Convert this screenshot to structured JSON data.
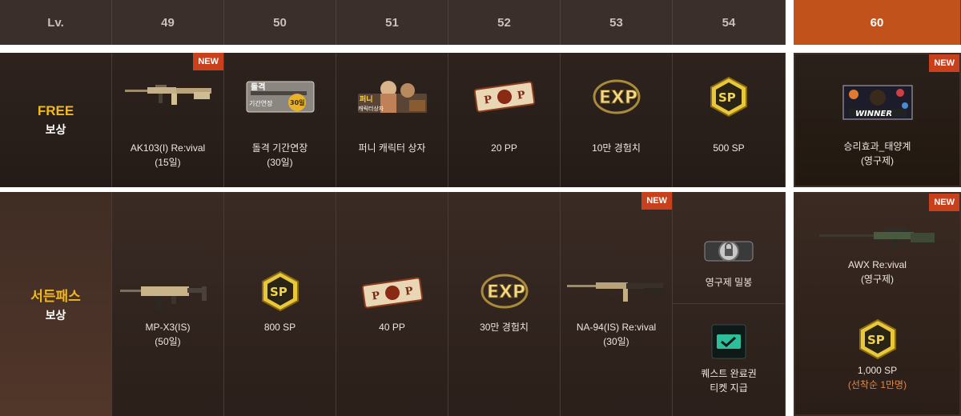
{
  "header": {
    "level_label": "Lv.",
    "levels": [
      "49",
      "50",
      "51",
      "52",
      "53",
      "54"
    ],
    "final_level": "60"
  },
  "free_row": {
    "title": "FREE",
    "subtitle": "보상",
    "items": [
      {
        "name": "AK103(I) Re:vival",
        "sub": "(15일)",
        "new": "NEW",
        "icon": "rifle-icon"
      },
      {
        "name": "돌격 기간연장",
        "sub": "(30일)",
        "icon": "extension-ticket-icon",
        "icon_text": "돌격\n기간연장",
        "icon_badge": "30일"
      },
      {
        "name": "퍼니 캐릭터 상자",
        "sub": "",
        "icon": "character-box-icon",
        "icon_text": "퍼니\n캐릭터상자"
      },
      {
        "name": "20 PP",
        "sub": "",
        "icon": "pp-ticket-icon",
        "icon_text": "P O P"
      },
      {
        "name": "10만 경험치",
        "sub": "",
        "icon": "exp-badge-icon",
        "icon_text": "EXP"
      },
      {
        "name": "500 SP",
        "sub": "",
        "icon": "sp-badge-icon",
        "icon_text": "SP"
      }
    ],
    "final": {
      "name": "승리효과_태양계",
      "sub": "(영구제)",
      "new": "NEW",
      "icon": "winner-effect-icon",
      "icon_text": "WINNER"
    }
  },
  "sudden_row": {
    "title": "서든패스",
    "subtitle": "보상",
    "items": [
      {
        "name": "MP-X3(IS)",
        "sub": "(50일)",
        "icon": "smg-icon"
      },
      {
        "name": "800 SP",
        "sub": "",
        "icon": "sp-badge-icon",
        "icon_text": "SP"
      },
      {
        "name": "40 PP",
        "sub": "",
        "icon": "pp-ticket-icon",
        "icon_text": "P O P"
      },
      {
        "name": "30만 경험치",
        "sub": "",
        "icon": "exp-badge-icon",
        "icon_text": "EXP"
      },
      {
        "name": "NA-94(IS) Re:vival",
        "sub": "(30일)",
        "new": "NEW",
        "icon": "rifle-icon"
      }
    ],
    "split_item_top": {
      "name": "영구제 밀봉",
      "icon": "seal-lock-icon"
    },
    "split_item_bottom": {
      "name": "퀘스트 완료권",
      "sub": "티켓 지급",
      "icon": "quest-ticket-icon"
    },
    "final_top": {
      "name": "AWX Re:vival",
      "sub": "(영구제)",
      "new": "NEW",
      "icon": "sniper-rifle-icon"
    },
    "final_bottom": {
      "name": "1,000 SP",
      "sub": "(선착순 1만명)",
      "icon": "sp-badge-icon",
      "icon_text": "SP"
    }
  },
  "colors": {
    "accent": "#c2521c",
    "gold": "#f0b821",
    "header_bg": "#3a2f2b"
  }
}
